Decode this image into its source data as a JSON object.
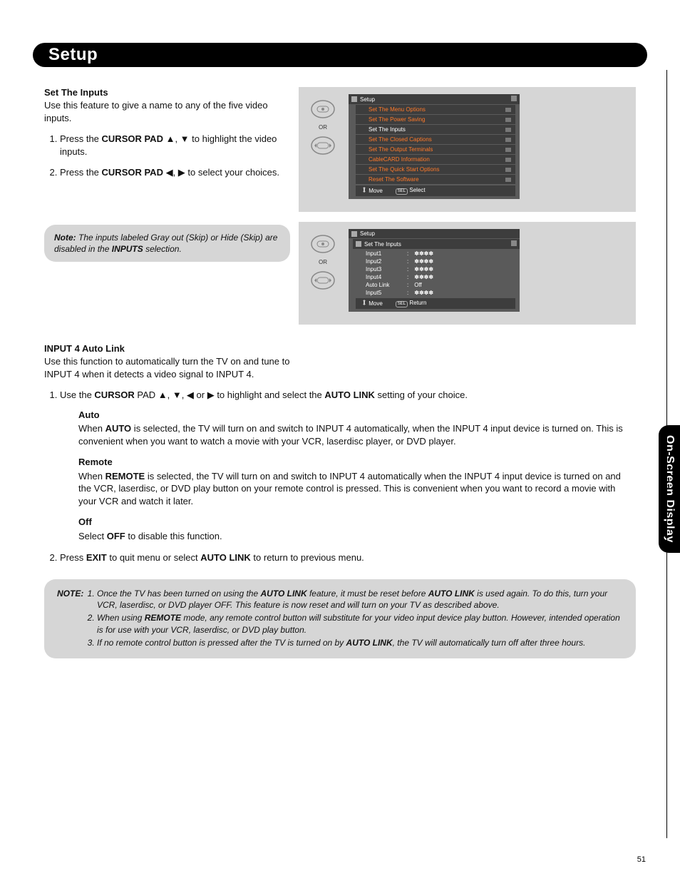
{
  "header": {
    "title": "Setup"
  },
  "sideTab": "On-Screen Display",
  "pageNumber": "51",
  "setInputs": {
    "heading": "Set The Inputs",
    "intro": "Use this feature to give a name to any of the five video inputs.",
    "step1_a": "Press the ",
    "step1_b": "CURSOR PAD",
    "step1_c": " ▲, ▼ to highlight the video inputs.",
    "step2_a": "Press the ",
    "step2_b": "CURSOR PAD",
    "step2_c": " ◀, ▶ to select your choices."
  },
  "note1": {
    "label": "Note:",
    "text_a": "The inputs labeled Gray out (Skip) or Hide (Skip) are disabled in the ",
    "text_b": "INPUTS",
    "text_c": " selection."
  },
  "screen1": {
    "or": "OR",
    "title": "Setup",
    "items": [
      "Set The Menu Options",
      "Set The Power Saving",
      "Set The Inputs",
      "Set The Closed Captions",
      "Set The Output Terminals",
      "CableCARD Information",
      "Set The Quick Start Options",
      "Reset The Software"
    ],
    "footerMove": "Move",
    "footerSel": "SEL",
    "footerSelect": "Select"
  },
  "screen2": {
    "or": "OR",
    "title": "Setup",
    "subtitle": "Set The Inputs",
    "rows": [
      {
        "label": "Input1",
        "value": "✽✽✽✽"
      },
      {
        "label": "Input2",
        "value": "✽✽✽✽"
      },
      {
        "label": "Input3",
        "value": "✽✽✽✽"
      },
      {
        "label": "Input4",
        "value": "✽✽✽✽"
      },
      {
        "label": "Auto Link",
        "value": "Off"
      },
      {
        "label": "Input5",
        "value": "✽✽✽✽"
      }
    ],
    "footerMove": "Move",
    "footerSel": "SEL",
    "footerReturn": "Return"
  },
  "autoLink": {
    "heading": "INPUT 4 Auto Link",
    "intro": "Use this function to automatically turn the TV on and tune to INPUT 4 when it detects a video signal to INPUT 4.",
    "step1_a": "Use the ",
    "step1_b": "CURSOR",
    "step1_c": " PAD ▲, ▼, ◀ or ▶ to highlight and select the ",
    "step1_d": "AUTO LINK",
    "step1_e": " setting of your choice.",
    "autoH": "Auto",
    "auto_a": "When ",
    "auto_b": "AUTO",
    "auto_c": " is selected, the TV will turn on and switch to INPUT 4 automatically, when the INPUT 4 input device is turned on. This is convenient when you want to watch a movie with your VCR, laserdisc player, or DVD player.",
    "remoteH": "Remote",
    "remote_a": "When ",
    "remote_b": "REMOTE",
    "remote_c": " is selected, the TV will turn on and switch to INPUT 4 automatically when the INPUT 4 input device is turned on and the VCR, laserdisc, or DVD play button on your remote control is pressed. This is convenient when you want to record a movie with your VCR and watch it later.",
    "offH": "Off",
    "off_a": "Select ",
    "off_b": "OFF",
    "off_c": " to disable this function.",
    "step2_a": "Press ",
    "step2_b": "EXIT",
    "step2_c": " to quit menu or select ",
    "step2_d": "AUTO LINK",
    "step2_e": " to return to previous menu."
  },
  "note2": {
    "label": "NOTE:",
    "i1_a": "Once the TV has been turned on using the ",
    "i1_b": "AUTO LINK",
    "i1_c": " feature, it must be reset before ",
    "i1_d": "AUTO LINK",
    "i1_e": " is used again. To do this, turn your VCR, laserdisc, or DVD player OFF. This feature is now reset and will turn on your TV as described above.",
    "i2_a": "When using ",
    "i2_b": "REMOTE",
    "i2_c": " mode, any remote control button will substitute for your video input device play button. However, intended operation is for use with your VCR, laserdisc, or DVD play button.",
    "i3_a": "If no remote control button is pressed after the TV is turned on by ",
    "i3_b": "AUTO LINK",
    "i3_c": ", the TV will automatically turn off after three hours."
  }
}
